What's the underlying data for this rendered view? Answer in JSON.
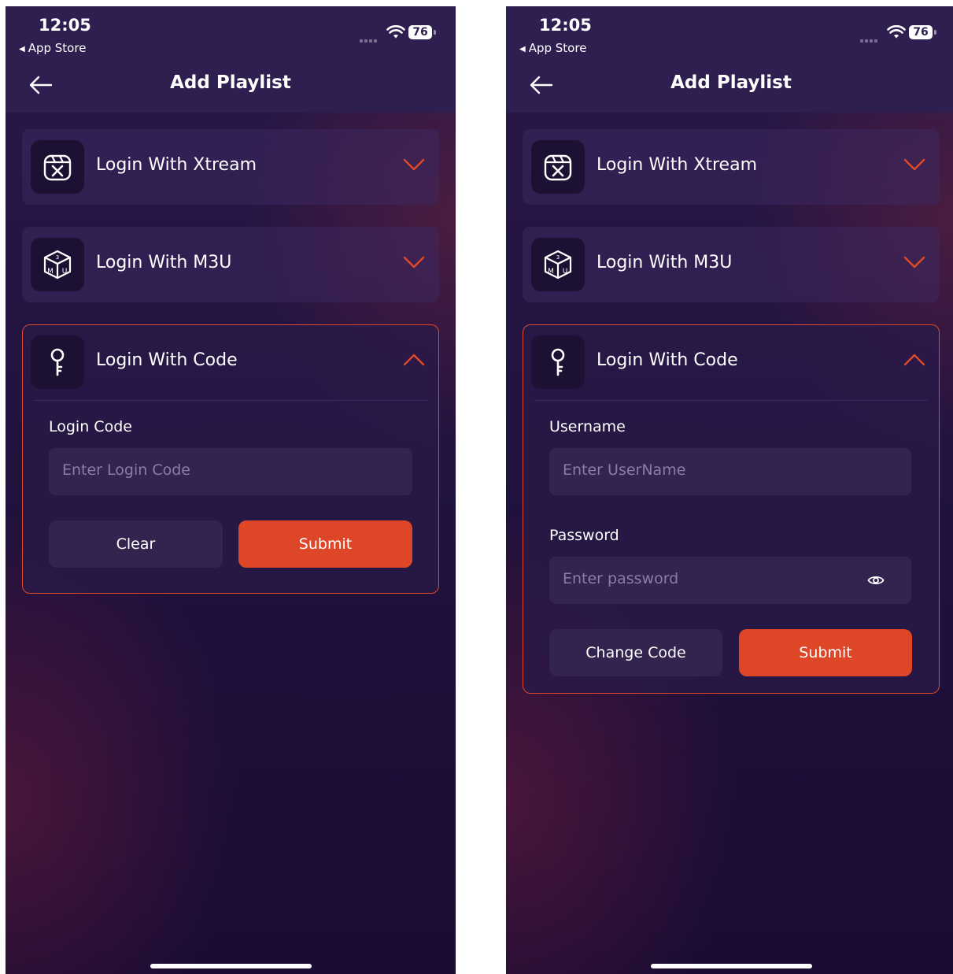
{
  "status_bar": {
    "time": "12:05",
    "back_app": "App Store",
    "battery": "76"
  },
  "header": {
    "title": "Add Playlist"
  },
  "cards": {
    "xtream": {
      "label": "Login With Xtream",
      "icon": "xtream-icon"
    },
    "m3u": {
      "label": "Login With M3U",
      "icon": "m3u-box-icon"
    },
    "code": {
      "label": "Login With Code",
      "icon": "key-icon"
    }
  },
  "left_form": {
    "code_label": "Login Code",
    "code_placeholder": "Enter Login Code",
    "clear_label": "Clear",
    "submit_label": "Submit"
  },
  "right_form": {
    "username_label": "Username",
    "username_placeholder": "Enter UserName",
    "password_label": "Password",
    "password_placeholder": "Enter password",
    "change_code_label": "Change Code",
    "submit_label": "Submit"
  },
  "colors": {
    "accent": "#dd4728",
    "background": "#1a0c33",
    "header": "#2f1f50",
    "card": "#2e1d4d"
  }
}
